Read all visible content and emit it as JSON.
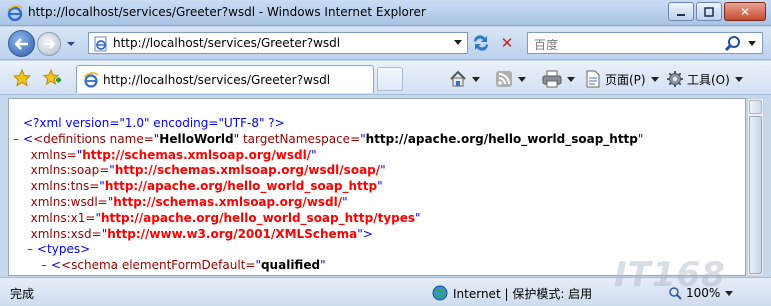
{
  "window": {
    "title": "http://localhost/services/Greeter?wsdl - Windows Internet Explorer"
  },
  "address": {
    "url": "http://localhost/services/Greeter?wsdl"
  },
  "search": {
    "placeholder": "百度"
  },
  "tab": {
    "title": "http://localhost/services/Greeter?wsdl"
  },
  "commands": {
    "page_label": "页面(P)",
    "tools_label": "工具(O)"
  },
  "xml": {
    "decl": "<?xml version=\"1.0\" encoding=\"UTF-8\" ?>",
    "definitions_open": "<definitions",
    "name_attr": " name=",
    "name_value": "HelloWorld",
    "target_attr": " targetNamespace=",
    "target_value": "http://apache.org/hello_world_soap_http",
    "ns": [
      {
        "attr": "xmlns=",
        "value": "http://schemas.xmlsoap.org/wsdl/"
      },
      {
        "attr": "xmlns:soap=",
        "value": "http://schemas.xmlsoap.org/wsdl/soap/"
      },
      {
        "attr": "xmlns:tns=",
        "value": "http://apache.org/hello_world_soap_http"
      },
      {
        "attr": "xmlns:wsdl=",
        "value": "http://schemas.xmlsoap.org/wsdl/"
      },
      {
        "attr": "xmlns:x1=",
        "value": "http://apache.org/hello_world_soap_http/types"
      },
      {
        "attr": "xmlns:xsd=",
        "value": "http://www.w3.org/2001/XMLSchema"
      }
    ],
    "types_tag": "<types>",
    "schema_open": "<schema elementFormDefault=",
    "schema_value": "qualified"
  },
  "status": {
    "text": "完成",
    "zone": "Internet | 保护模式: 启用",
    "zoom": "100%"
  },
  "watermark": "IT168"
}
